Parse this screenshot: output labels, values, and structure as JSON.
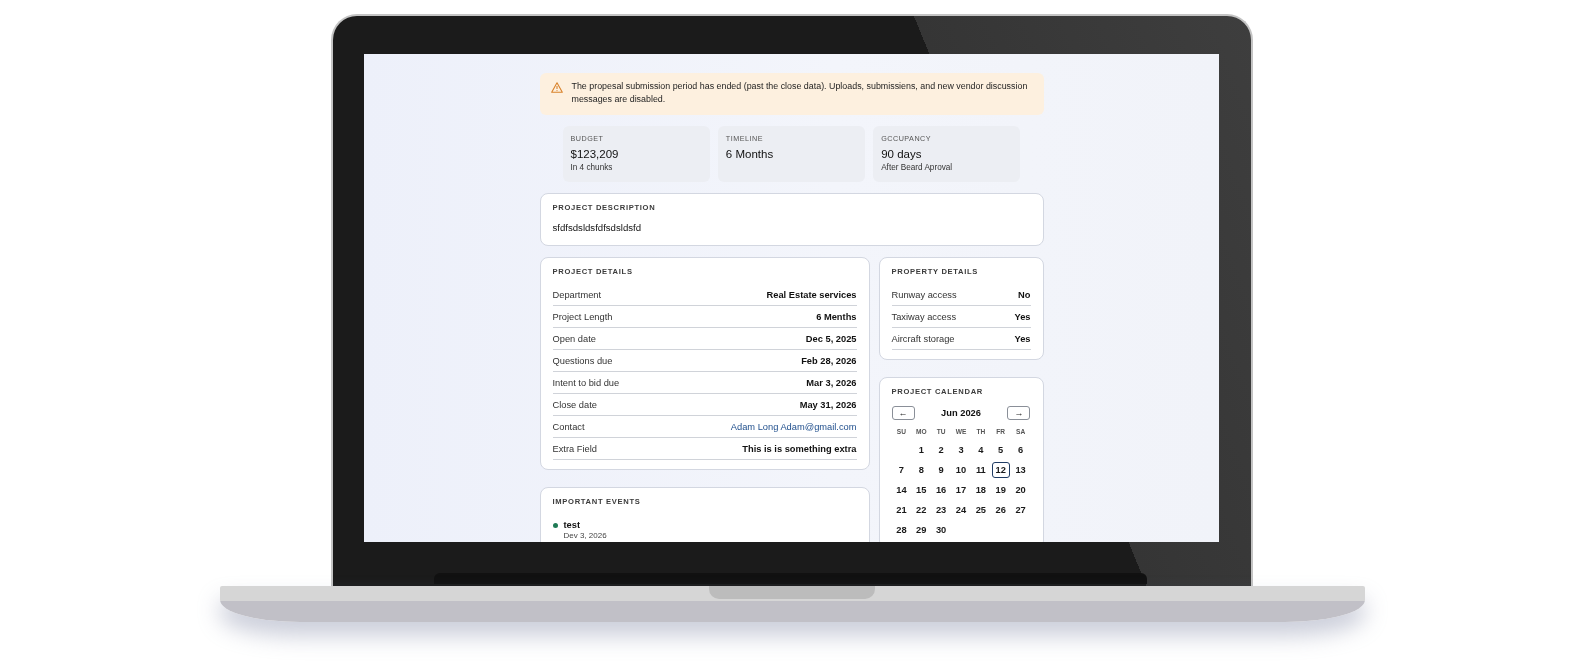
{
  "alert": {
    "message": "The propesal submission period has ended (past the close data). Uploads, submissiens, and new vendor discussion messages are disabled."
  },
  "stats": [
    {
      "label": "BUDGET",
      "value": "$123,209",
      "note": "In 4 chunks"
    },
    {
      "label": "TIMELINE",
      "value": "6 Months"
    },
    {
      "label": "GCCUPANCY",
      "value": "90 days",
      "note": "After Beard Aproval"
    }
  ],
  "description": {
    "title": "PROJECT DESCRIPTION",
    "text": "sfdfsdsldsfdfsdsldsfd"
  },
  "project_details": {
    "title": "PROJECT DETAILS",
    "rows": [
      {
        "label": "Department",
        "value": "Real Estate services",
        "kind": "text"
      },
      {
        "label": "Project Length",
        "value": "6 Menths",
        "kind": "text"
      },
      {
        "label": "Open date",
        "value": "Dec 5, 2025",
        "kind": "text"
      },
      {
        "label": "Questions due",
        "value": "Feb 28, 2026",
        "kind": "text"
      },
      {
        "label": "Intent to bid due",
        "value": "Mar 3, 2026",
        "kind": "text"
      },
      {
        "label": "Close date",
        "value": "May 31, 2026",
        "kind": "text"
      },
      {
        "label": "Contact",
        "value": "Adam Long Adam@gmail.com",
        "kind": "link"
      },
      {
        "label": "Extra Field",
        "value": "This is is something extra",
        "kind": "text"
      }
    ]
  },
  "property_details": {
    "title": "PROPERTY DETAILS",
    "rows": [
      {
        "label": "Runway access",
        "value": "No",
        "kind": "text"
      },
      {
        "label": "Taxiway access",
        "value": "Yes",
        "kind": "text"
      },
      {
        "label": "Aircraft storage",
        "value": "Yes",
        "kind": "text"
      }
    ]
  },
  "calendar": {
    "title": "PROJECT CALENDAR",
    "prev": "←",
    "next": "→",
    "month": "Jun 2026",
    "weekdays": [
      "SU",
      "MO",
      "TU",
      "WE",
      "TH",
      "FR",
      "SA"
    ],
    "weeks": [
      [
        {
          "day": "1",
          "selected": false
        },
        {
          "day": "2",
          "selected": false
        },
        {
          "day": "3",
          "selected": false
        },
        {
          "day": "4",
          "selected": false
        },
        {
          "day": "5",
          "selected": false
        },
        {
          "day": "6",
          "selected": false
        }
      ],
      [
        {
          "day": "7",
          "selected": false
        },
        {
          "day": "8",
          "selected": false
        },
        {
          "day": "9",
          "selected": false
        },
        {
          "day": "10",
          "selected": false
        },
        {
          "day": "11",
          "selected": false
        },
        {
          "day": "12",
          "selected": true
        },
        {
          "day": "13",
          "selected": false
        }
      ],
      [
        {
          "day": "14",
          "selected": false
        },
        {
          "day": "15",
          "selected": false
        },
        {
          "day": "16",
          "selected": false
        },
        {
          "day": "17",
          "selected": false
        },
        {
          "day": "18",
          "selected": false
        },
        {
          "day": "19",
          "selected": false
        },
        {
          "day": "20",
          "selected": false
        }
      ],
      [
        {
          "day": "21",
          "selected": false
        },
        {
          "day": "22",
          "selected": false
        },
        {
          "day": "23",
          "selected": false
        },
        {
          "day": "24",
          "selected": false
        },
        {
          "day": "25",
          "selected": false
        },
        {
          "day": "26",
          "selected": false
        },
        {
          "day": "27",
          "selected": false
        }
      ],
      [
        {
          "day": "28",
          "selected": false
        },
        {
          "day": "29",
          "selected": false
        },
        {
          "day": "30",
          "selected": false
        }
      ]
    ]
  },
  "events": {
    "title": "IMPORTANT EVENTS",
    "items": [
      {
        "title": "test",
        "date": "Dev 3, 2026",
        "color": "#1f7a55"
      }
    ]
  }
}
